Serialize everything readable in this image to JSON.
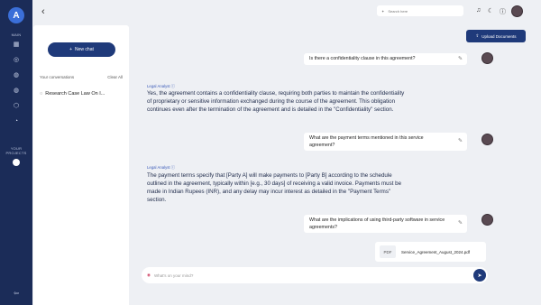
{
  "app": {
    "logo": "A"
  },
  "rail": {
    "main_label": "MAIN",
    "projects_label": "YOUR PROJECTS",
    "icons": [
      "dashboard-icon",
      "compass-icon",
      "globe-icon",
      "globe-icon",
      "shield-icon",
      "chat-icon",
      "history-icon"
    ]
  },
  "sidebar": {
    "new_chat": "New chat",
    "conversations_label": "Your conversations",
    "clear_all": "Clear All",
    "conversations": [
      {
        "title": "Research Case Law On I..."
      }
    ]
  },
  "header": {
    "search_placeholder": "Search here",
    "upload_button": "Upload Documents"
  },
  "messages": [
    {
      "role": "user",
      "text": "Is there a confidentiality clause in this agreement?"
    },
    {
      "role": "assistant",
      "author": "Legal Analyst",
      "text": "Yes, the agreement contains a confidentiality clause, requiring both parties to maintain the confidentiality of proprietary or sensitive information exchanged during the course of the agreement. This obligation continues even after the termination of the agreement and is detailed in the \"Confidentiality\" section."
    },
    {
      "role": "user",
      "text": "What are the payment terms mentioned in this service agreement?"
    },
    {
      "role": "assistant",
      "author": "Legal Analyst",
      "text": "The payment terms specify that [Party A] will make payments to [Party B] according to the schedule outlined in the agreement, typically within [e.g., 30 days] of receiving a valid invoice. Payments must be made in Indian Rupees (INR), and any delay may incur interest as detailed in the \"Payment Terms\" section."
    },
    {
      "role": "user",
      "text": "What are the implications of using third-party software in service agreements?"
    }
  ],
  "attachment": {
    "type": "PDF",
    "filename": "Service_Agreement_August_2024.pdf"
  },
  "composer": {
    "placeholder": "What's on your mind?"
  }
}
